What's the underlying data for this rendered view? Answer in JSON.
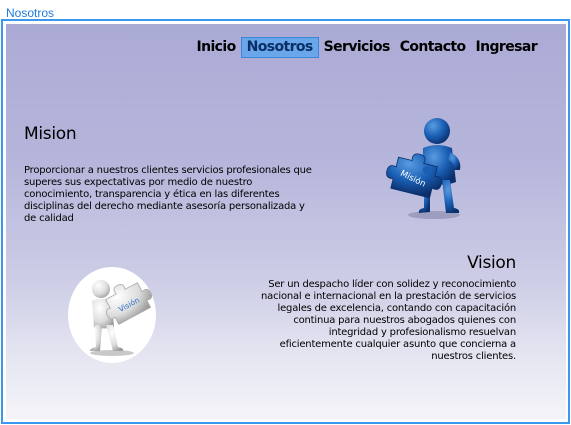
{
  "window": {
    "title": "Nosotros"
  },
  "nav": {
    "items": [
      {
        "label": "Inicio"
      },
      {
        "label": "Nosotros"
      },
      {
        "label": "Servicios"
      },
      {
        "label": "Contacto"
      },
      {
        "label": "Ingresar"
      }
    ],
    "active_index": 1
  },
  "mision": {
    "title": "Mision",
    "text": "Proporcionar a nuestros clientes servicios profesionales que superes sus expectativas por medio de nuestro conocimiento, transparencia y ética en las diferentes disciplinas del derecho mediante asesoría personalizada y de calidad",
    "image_label": "Misión",
    "image_icon": "puzzle-figure-blue-icon"
  },
  "vision": {
    "title": "Vision",
    "text": "Ser un despacho líder con solidez y reconocimiento nacional e internacional en la prestación de servicios legales de excelencia, contando con capacitación continua para nuestros abogados quienes con integridad y profesionalismo resuelvan eficientemente cualquier asunto que concierna a nuestros clientes.",
    "image_label": "Visión",
    "image_icon": "puzzle-figure-white-icon"
  },
  "colors": {
    "accent": "#3b98ee",
    "nav_active_bg": "#6aa6ea",
    "background_top": "#aaaad6",
    "background_bottom": "#f4f4f8"
  }
}
